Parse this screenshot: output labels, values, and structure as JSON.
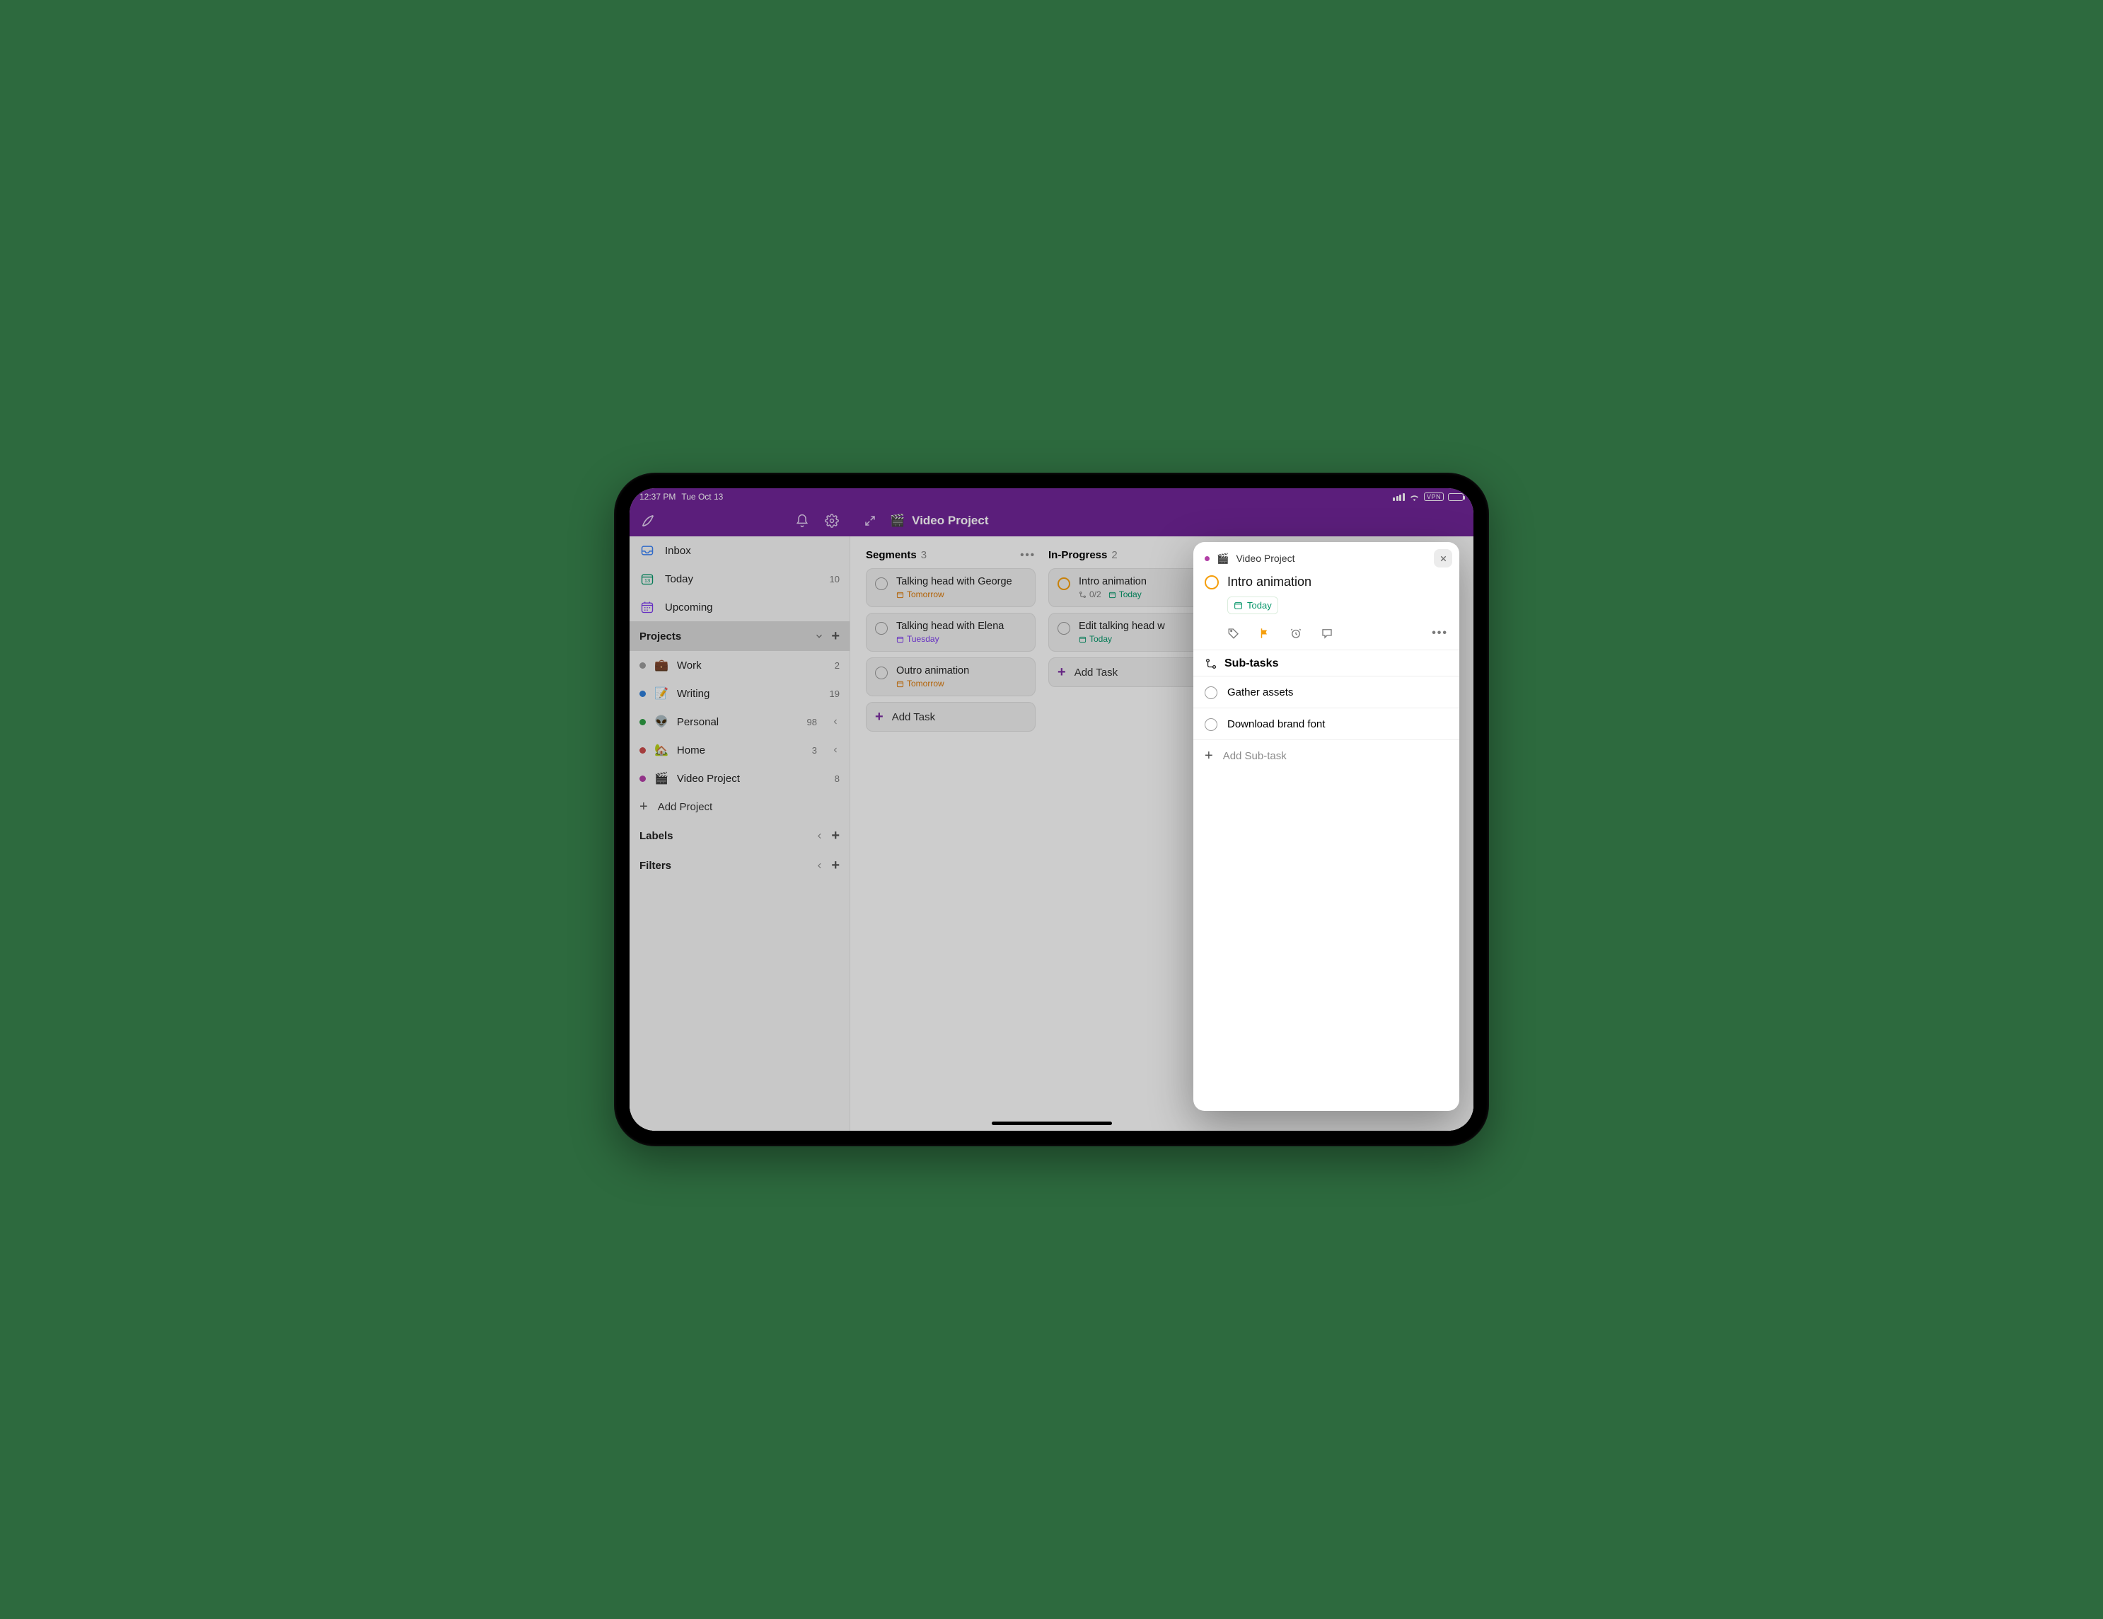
{
  "status": {
    "time": "12:37 PM",
    "date": "Tue Oct 13",
    "vpn": "VPN"
  },
  "appbar": {
    "project_emoji": "🎬",
    "project_title": "Video Project"
  },
  "sidebar": {
    "inbox": "Inbox",
    "today": "Today",
    "today_count": "10",
    "upcoming": "Upcoming",
    "projects_header": "Projects",
    "labels_header": "Labels",
    "filters_header": "Filters",
    "add_project": "Add Project",
    "projects": [
      {
        "dot": "#9a9a9a",
        "emoji": "💼",
        "name": "Work",
        "count": "2",
        "caret": false
      },
      {
        "dot": "#2e7dd7",
        "emoji": "📝",
        "name": "Writing",
        "count": "19",
        "caret": false
      },
      {
        "dot": "#2e9e44",
        "emoji": "👽",
        "name": "Personal",
        "count": "98",
        "caret": true
      },
      {
        "dot": "#c84b4b",
        "emoji": "🏡",
        "name": "Home",
        "count": "3",
        "caret": true
      },
      {
        "dot": "#b23fa6",
        "emoji": "🎬",
        "name": "Video Project",
        "count": "8",
        "caret": false
      }
    ]
  },
  "board": {
    "add_task_label": "Add Task",
    "columns": [
      {
        "name": "Segments",
        "count": "3",
        "cards": [
          {
            "title": "Talking head with George",
            "meta": [
              {
                "cls": "tag-amber",
                "icon": "cal",
                "text": "Tomorrow"
              }
            ],
            "priority": false
          },
          {
            "title": "Talking head with Elena",
            "meta": [
              {
                "cls": "tag-purple",
                "icon": "cal",
                "text": "Tuesday"
              }
            ],
            "priority": false
          },
          {
            "title": "Outro animation",
            "meta": [
              {
                "cls": "tag-amber",
                "icon": "cal",
                "text": "Tomorrow"
              }
            ],
            "priority": false
          }
        ]
      },
      {
        "name": "In-Progress",
        "count": "2",
        "cards": [
          {
            "title": "Intro animation",
            "meta": [
              {
                "cls": "tag-grey",
                "icon": "sub",
                "text": "0/2"
              },
              {
                "cls": "tag-green",
                "icon": "cal",
                "text": "Today"
              }
            ],
            "priority": true
          },
          {
            "title": "Edit talking head w",
            "meta": [
              {
                "cls": "tag-green",
                "icon": "cal",
                "text": "Today"
              }
            ],
            "priority": false
          }
        ]
      }
    ]
  },
  "panel": {
    "breadcrumb_emoji": "🎬",
    "breadcrumb": "Video Project",
    "title": "Intro animation",
    "date_chip": "Today",
    "subtasks_header": "Sub-tasks",
    "subtasks": [
      {
        "title": "Gather assets"
      },
      {
        "title": "Download brand font"
      }
    ],
    "add_sub": "Add Sub-task"
  }
}
